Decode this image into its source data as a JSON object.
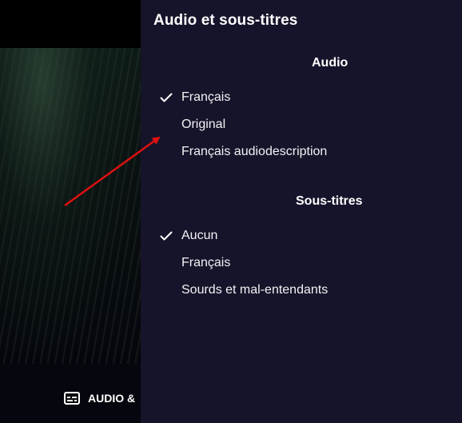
{
  "panel": {
    "title": "Audio et sous-titres",
    "audio_section": {
      "title": "Audio",
      "options": [
        {
          "label": "Français",
          "selected": true
        },
        {
          "label": "Original",
          "selected": false
        },
        {
          "label": "Français audiodescription",
          "selected": false
        }
      ]
    },
    "subtitles_section": {
      "title": "Sous-titres",
      "options": [
        {
          "label": "Aucun",
          "selected": true
        },
        {
          "label": "Français",
          "selected": false
        },
        {
          "label": "Sourds et mal-entendants",
          "selected": false
        }
      ]
    }
  },
  "player": {
    "audio_subtitles_button_label": "AUDIO &",
    "icon": "subtitles-icon"
  },
  "annotation": {
    "color": "#e01010"
  },
  "colors": {
    "panel_bg": "#16142a",
    "check": "#ffffff"
  }
}
